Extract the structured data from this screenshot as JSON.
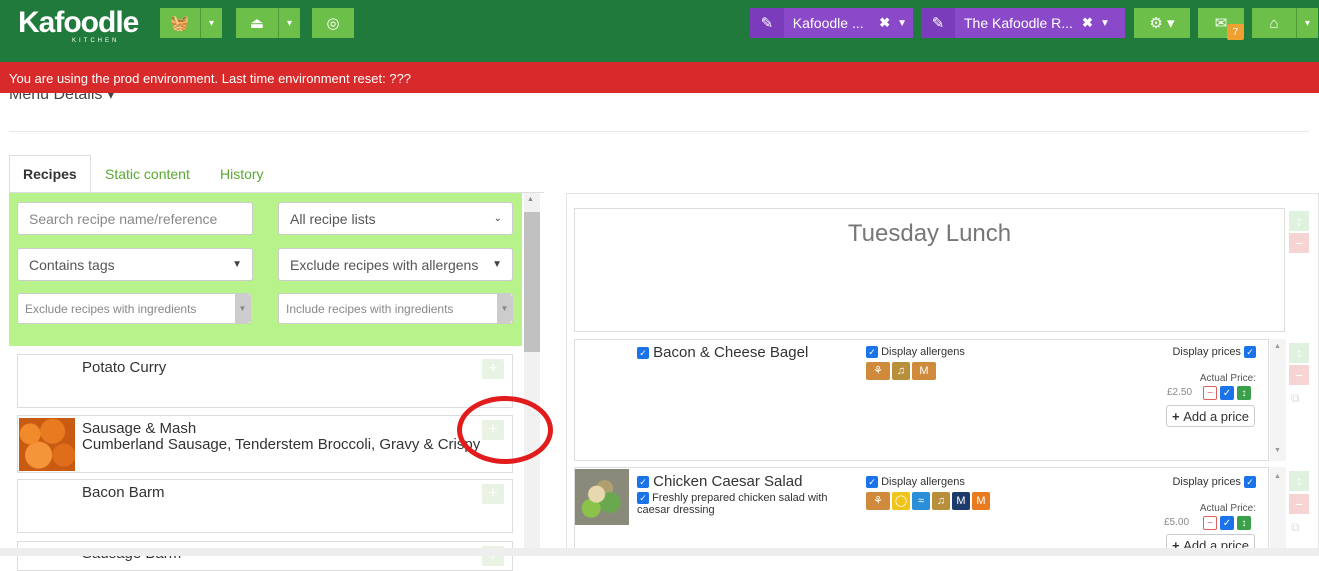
{
  "nav": {
    "logo": "Kafoodle",
    "logo_sub": "KITCHEN",
    "project_tab_1": "Kafoodle ...",
    "project_tab_2": "The Kafoodle R...",
    "message_count": "7"
  },
  "alert": "You are using the prod environment. Last time environment reset: ???",
  "page": {
    "section_title": "Menu Details"
  },
  "tabs": [
    "Recipes",
    "Static content",
    "History"
  ],
  "filters": {
    "search_placeholder": "Search recipe name/reference",
    "recipe_lists": "All recipe lists",
    "contains_tags": "Contains tags",
    "exclude_allergens": "Exclude recipes with allergens",
    "exclude_ingredients": "Exclude recipes with ingredients",
    "include_ingredients": "Include recipes with ingredients"
  },
  "recipes": [
    {
      "name": "Potato Curry",
      "description": ""
    },
    {
      "name": "Sausage & Mash",
      "description": "Cumberland Sausage, Tenderstem Broccoli, Gravy & Crispy"
    },
    {
      "name": "Bacon Barm",
      "description": ""
    },
    {
      "name": "Sausage Barm",
      "description": ""
    }
  ],
  "menu": {
    "title": "Tuesday Lunch",
    "items": [
      {
        "name": "Bacon & Cheese Bagel",
        "description": "",
        "display_allergens": "Display allergens",
        "display_prices": "Display prices",
        "actual_price_label": "Actual Price:",
        "price": "£2.50",
        "add_price": "Add a price",
        "allergen_icons": [
          "gluten-icon",
          "mustard-icon",
          "milk-icon"
        ]
      },
      {
        "name": "Chicken Caesar Salad",
        "description": "Freshly prepared chicken salad with caesar dressing",
        "display_allergens": "Display allergens",
        "display_prices": "Display prices",
        "actual_price_label": "Actual Price:",
        "price": "£5.00",
        "add_price": "Add a price",
        "allergen_icons": [
          "gluten-icon",
          "egg-icon",
          "fish-icon",
          "mustard-icon",
          "molluscs-icon",
          "milk-icon"
        ]
      }
    ]
  },
  "colors": {
    "navbar": "#1f7a3c",
    "green_button": "#6cc04a",
    "purple_button": "#8a49c9",
    "alert": "#d82a2a",
    "filter_panel": "#b7f28a",
    "checkbox": "#1a73e8",
    "annotation_circle": "#e21c1c"
  }
}
